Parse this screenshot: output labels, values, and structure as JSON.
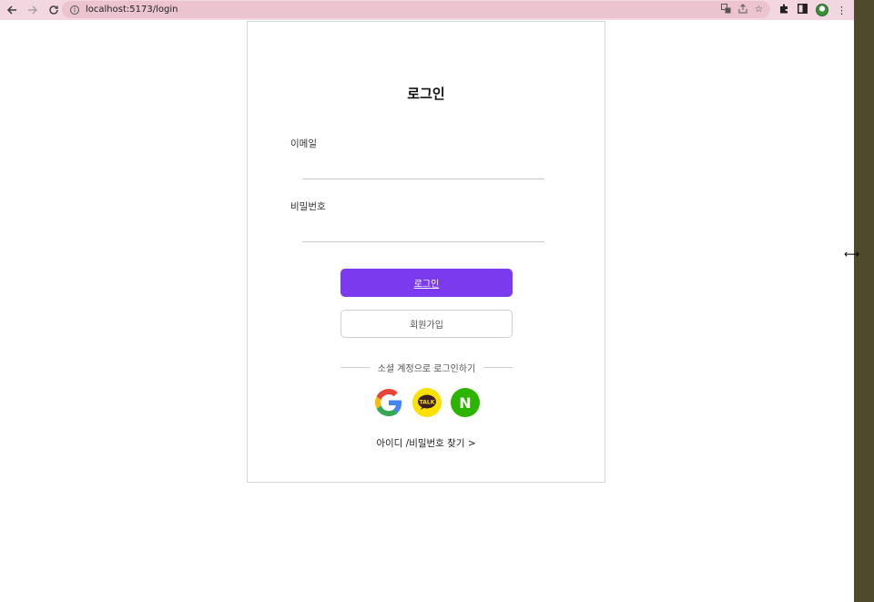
{
  "browser": {
    "url": "localhost:5173/login",
    "icons": [
      "back-icon",
      "forward-icon",
      "reload-icon",
      "info-icon",
      "translate-icon",
      "share-icon",
      "bookmark-star-icon",
      "extensions-icon",
      "side-panel-icon",
      "profile-avatar",
      "menu-icon"
    ]
  },
  "login": {
    "title": "로그인",
    "email_label": "이메일",
    "email_value": "",
    "password_label": "비밀번호",
    "password_value": "",
    "login_button": "로그인",
    "signup_button": "회원가입",
    "social_divider": "소셜 계정으로 로그인하기",
    "social_icons": [
      "google-icon",
      "kakao-talk-icon",
      "naver-icon"
    ],
    "kakao_badge": "TALK",
    "naver_letter": "N",
    "find_link": "아이디 /비밀번호 찾기 >"
  },
  "colors": {
    "primary": "#7b3aed",
    "kakao": "#fae100",
    "naver": "#2db400",
    "toolbar": "#f3d7e0"
  }
}
